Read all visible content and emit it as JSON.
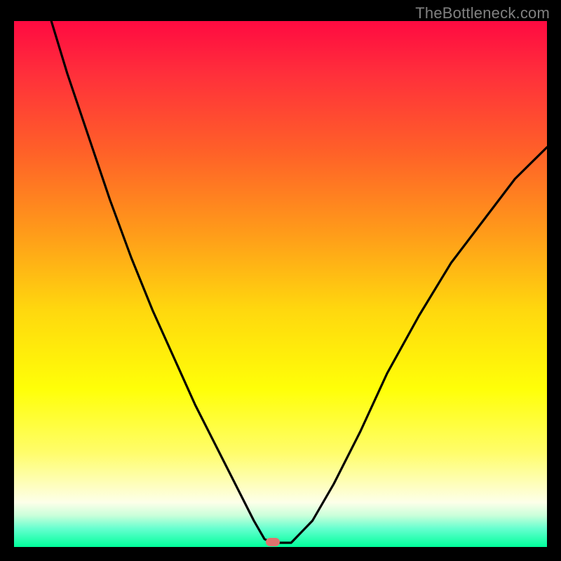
{
  "watermark": "TheBottleneck.com",
  "colors": {
    "page_bg": "#000000",
    "watermark": "#808080",
    "curve": "#000000",
    "marker": "#e0726e",
    "gradient_top": "#ff0a41",
    "gradient_bottom": "#00ff9b"
  },
  "marker": {
    "x_pct": 48.5,
    "y_pct": 99.0
  },
  "chart_data": {
    "type": "line",
    "title": "",
    "xlabel": "",
    "ylabel": "",
    "xlim": [
      0,
      100
    ],
    "ylim": [
      0,
      100
    ],
    "grid": false,
    "legend": false,
    "note": "x and y are percentage coordinates of the plot area (0=left/bottom edge of gradient, 100=right/top). Values are visually estimated; no axis ticks or numeric labels are present in the image.",
    "series": [
      {
        "name": "curve",
        "x": [
          7,
          10,
          14,
          18,
          22,
          26,
          30,
          34,
          38,
          42,
          45,
          47,
          48.5,
          52,
          56,
          60,
          65,
          70,
          76,
          82,
          88,
          94,
          100
        ],
        "y": [
          100,
          90,
          78,
          66,
          55,
          45,
          36,
          27,
          19,
          11,
          5,
          1.5,
          0.8,
          0.8,
          5,
          12,
          22,
          33,
          44,
          54,
          62,
          70,
          76
        ]
      }
    ],
    "marker_point": {
      "x": 48.5,
      "y": 0.8
    }
  }
}
